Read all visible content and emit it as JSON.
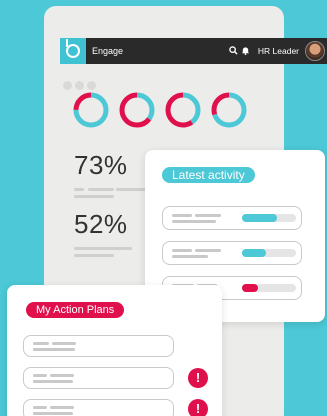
{
  "app": {
    "brand": "Engage",
    "user": "HR Leader",
    "icons": {
      "logo": "brand-logo-icon",
      "search": "search-icon",
      "bell": "bell-icon",
      "avatar": "user-avatar"
    }
  },
  "colors": {
    "teal": "#4cc8d6",
    "pink": "#e0104d",
    "light": "#e5e5e5"
  },
  "donuts": [
    {
      "teal": 0.75,
      "pink": 0.25
    },
    {
      "teal": 0.35,
      "pink": 0.65
    },
    {
      "teal": 0.4,
      "pink": 0.6
    },
    {
      "teal": 0.7,
      "pink": 0.3
    }
  ],
  "stats": [
    "73%",
    "52%"
  ],
  "latest_activity": {
    "title": "Latest activity",
    "rows": [
      {
        "progress": 0.65,
        "color": "#4cc8d6"
      },
      {
        "progress": 0.45,
        "color": "#4cc8d6"
      },
      {
        "progress": 0.3,
        "color": "#e0104d"
      }
    ]
  },
  "action_plans": {
    "title": "My Action Plans",
    "alert_glyph": "!"
  }
}
